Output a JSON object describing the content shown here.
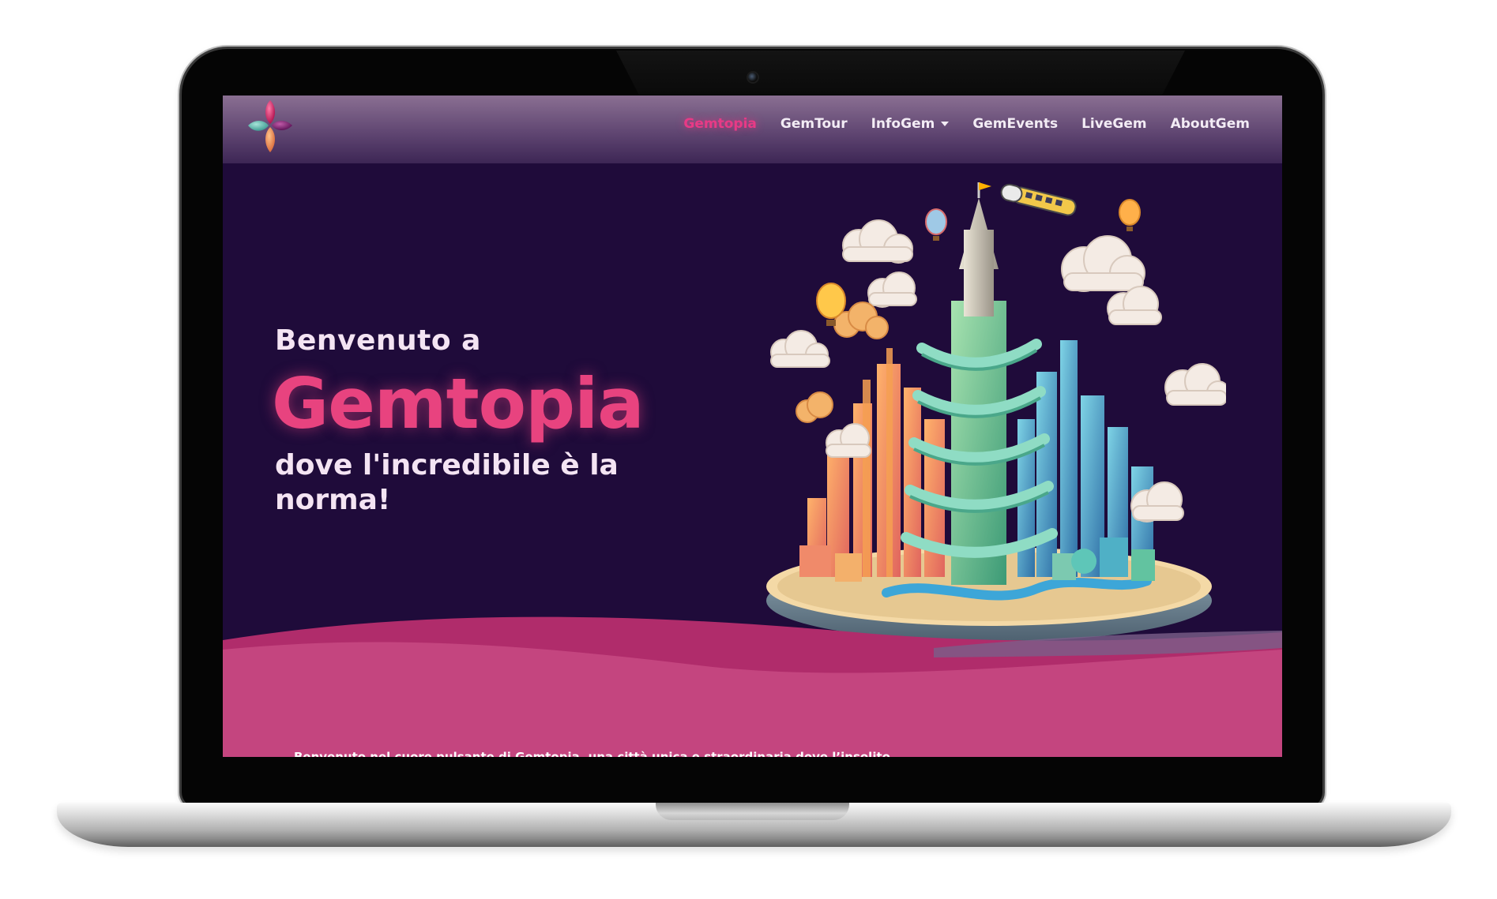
{
  "navbar": {
    "logo_icon": "gem-cluster-logo-icon",
    "items": [
      {
        "label": "Gemtopia",
        "active": true
      },
      {
        "label": "GemTour",
        "active": false
      },
      {
        "label": "InfoGem",
        "active": false,
        "dropdown": true
      },
      {
        "label": "GemEvents",
        "active": false
      },
      {
        "label": "LiveGem",
        "active": false
      },
      {
        "label": "AboutGem",
        "active": false
      }
    ]
  },
  "hero": {
    "welcome": "Benvenuto a",
    "brand": "Gemtopia",
    "tagline": "dove l'incredibile è la norma!",
    "illustration": "floating-city-illustration"
  },
  "intro": {
    "text": "Benvenuto nel cuore pulsante di Gemtopia, una città unica e straordinaria dove l’insolito"
  },
  "colors": {
    "background": "#1f0b3a",
    "accent": "#e8437f",
    "wave": "#c4457f",
    "text_light": "#f4e4f3"
  }
}
